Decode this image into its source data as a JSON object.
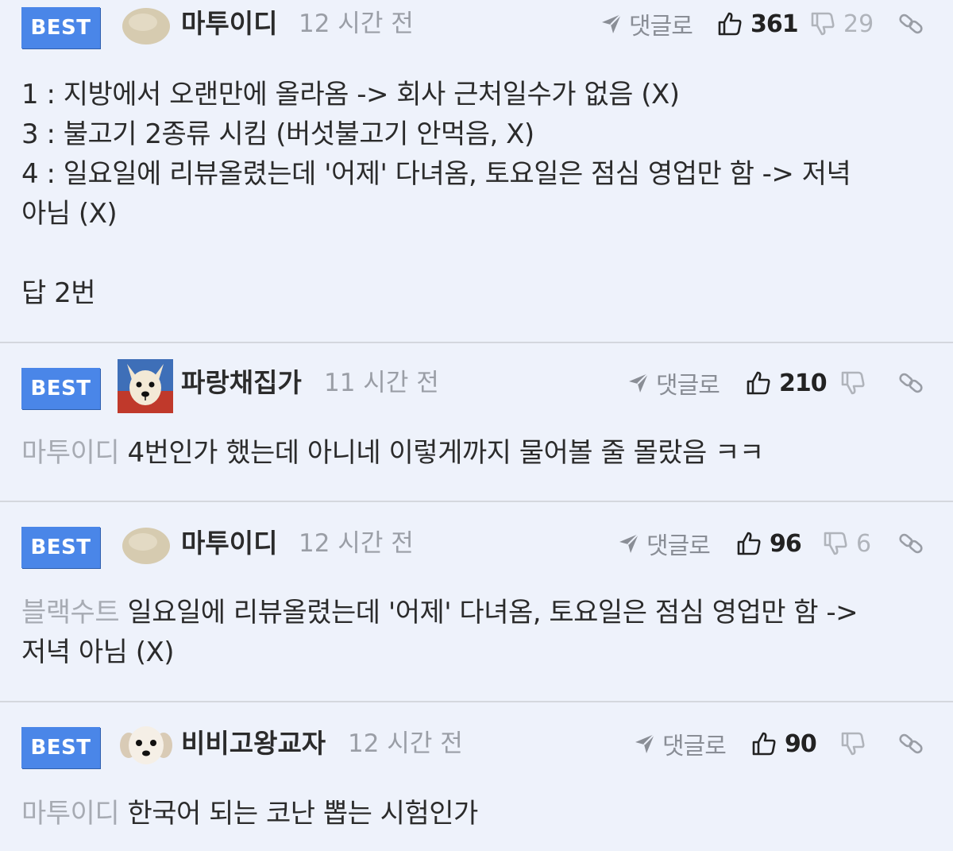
{
  "comments": [
    {
      "badge": "BEST",
      "avatar": "tan-blob-avatar",
      "nickname": "마투이디",
      "time": "12 시간 전",
      "reply_label": "댓글로",
      "up_count": "361",
      "down_count": "29",
      "body_lines": [
        "1 : 지방에서 오랜만에 올라옴 -> 회사 근처일수가 없음 (X)",
        "3 : 불고기 2종류 시킴 (버섯불고기 안먹음, X)",
        "4 : 일요일에 리뷰올렸는데 '어제' 다녀옴, 토요일은 점심 영업만 함 -> 저녁",
        "아님 (X)",
        "",
        "답 2번"
      ]
    },
    {
      "badge": "BEST",
      "avatar": "dog-photo-avatar",
      "nickname": "파랑채집가",
      "time": "11 시간 전",
      "reply_label": "댓글로",
      "up_count": "210",
      "down_count": "",
      "mention": "마투이디",
      "body_lines": [
        "4번인가 했는데 아니네 이렇게까지 물어볼 줄 몰랐음 ㅋㅋ"
      ]
    },
    {
      "badge": "BEST",
      "avatar": "tan-blob-avatar",
      "nickname": "마투이디",
      "time": "12 시간 전",
      "reply_label": "댓글로",
      "up_count": "96",
      "down_count": "6",
      "mention": "블랙수트",
      "body_lines": [
        "일요일에 리뷰올렸는데 '어제' 다녀옴, 토요일은 점심 영업만 함 ->",
        "저녁 아님 (X)"
      ]
    },
    {
      "badge": "BEST",
      "avatar": "puppy-avatar",
      "nickname": "비비고왕교자",
      "time": "12 시간 전",
      "reply_label": "댓글로",
      "up_count": "90",
      "down_count": "",
      "mention": "마투이디",
      "body_lines": [
        "한국어 되는 코난 뽑는 시험인가"
      ]
    }
  ],
  "icons": {
    "reply": "paper-plane-icon",
    "upvote": "thumbs-up-icon",
    "downvote": "thumbs-down-icon",
    "link": "link-icon"
  },
  "colors": {
    "background": "#eef2fb",
    "badge": "#4a86e8",
    "mention": "#a7abb3",
    "divider": "#d4d7de"
  }
}
